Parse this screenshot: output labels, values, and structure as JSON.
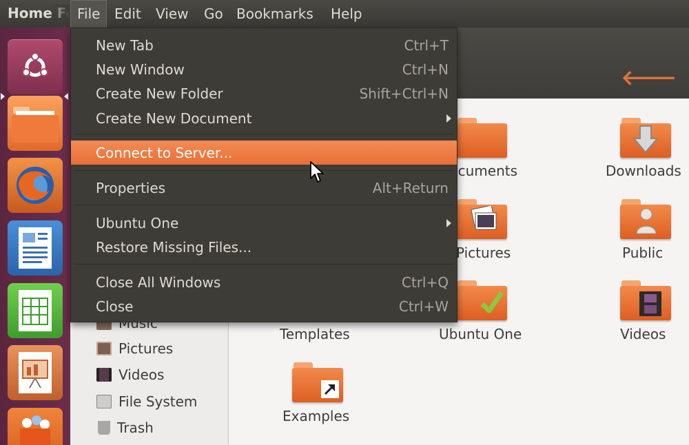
{
  "top_panel": {
    "app_title": "Home Folder",
    "menus": [
      "File",
      "Edit",
      "View",
      "Go",
      "Bookmarks",
      "Help"
    ]
  },
  "launcher": {
    "items": [
      "dash-home-icon",
      "files-folder-icon",
      "firefox-icon",
      "libreoffice-writer-icon",
      "libreoffice-calc-icon",
      "libreoffice-impress-icon",
      "software-center-icon"
    ]
  },
  "file_menu": {
    "items": [
      {
        "label": "New Tab",
        "shortcut": "Ctrl+T"
      },
      {
        "label": "New Window",
        "shortcut": "Ctrl+N"
      },
      {
        "label": "Create New Folder",
        "shortcut": "Shift+Ctrl+N"
      },
      {
        "label": "Create New Document",
        "shortcut": ""
      },
      {
        "label": "Connect to Server...",
        "shortcut": ""
      },
      {
        "label": "Properties",
        "shortcut": "Alt+Return"
      },
      {
        "label": "Ubuntu One",
        "shortcut": ""
      },
      {
        "label": "Restore Missing Files...",
        "shortcut": ""
      },
      {
        "label": "Close All Windows",
        "shortcut": "Ctrl+Q"
      },
      {
        "label": "Close",
        "shortcut": "Ctrl+W"
      }
    ]
  },
  "sidebar": {
    "items": [
      {
        "label": "Music"
      },
      {
        "label": "Pictures"
      },
      {
        "label": "Videos"
      },
      {
        "label": "File System"
      },
      {
        "label": "Trash"
      }
    ]
  },
  "folders": [
    {
      "label": "Documents"
    },
    {
      "label": "Downloads"
    },
    {
      "label": "Pictures"
    },
    {
      "label": "Public"
    },
    {
      "label": "Templates"
    },
    {
      "label": "Ubuntu One"
    },
    {
      "label": "Videos"
    },
    {
      "label": "Examples"
    }
  ],
  "colors": {
    "highlight": "#f07746",
    "panel": "#3c3b37",
    "launcher": "#632a47",
    "folder_orange": "#e8703a"
  }
}
